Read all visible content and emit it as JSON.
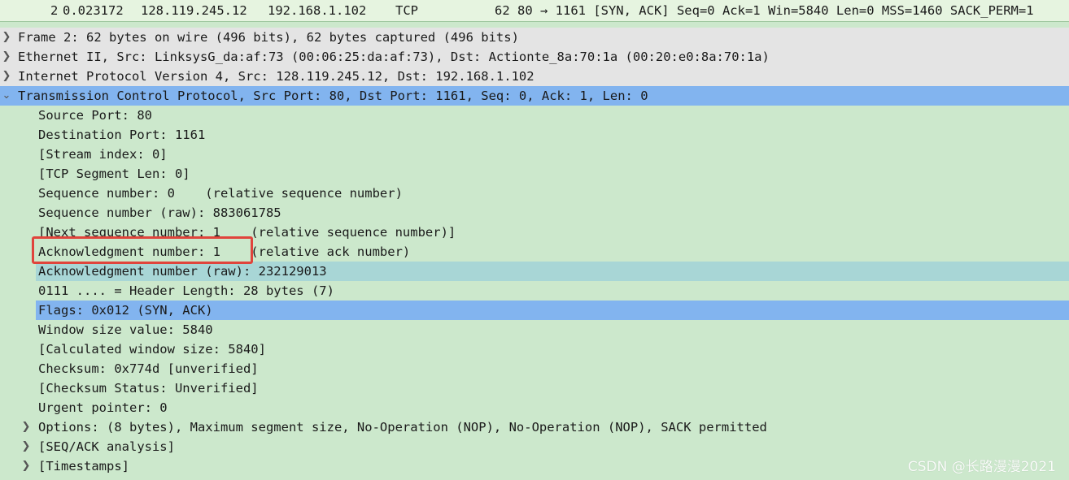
{
  "packet_row": {
    "no": "2",
    "time": "0.023172",
    "source": "128.119.245.12",
    "destination": "192.168.1.102",
    "protocol": "TCP",
    "info": "62 80 → 1161 [SYN, ACK] Seq=0 Ack=1 Win=5840 Len=0 MSS=1460 SACK_PERM=1"
  },
  "tree": {
    "frame": "Frame 2: 62 bytes on wire (496 bits), 62 bytes captured (496 bits)",
    "ethernet": "Ethernet II, Src: LinksysG_da:af:73 (00:06:25:da:af:73), Dst: Actionte_8a:70:1a (00:20:e0:8a:70:1a)",
    "ip": "Internet Protocol Version 4, Src: 128.119.245.12, Dst: 192.168.1.102",
    "tcp": "Transmission Control Protocol, Src Port: 80, Dst Port: 1161, Seq: 0, Ack: 1, Len: 0",
    "tcp_fields": {
      "source_port": "Source Port: 80",
      "destination_port": "Destination Port: 1161",
      "stream_index": "[Stream index: 0]",
      "segment_len": "[TCP Segment Len: 0]",
      "seq_number": "Sequence number: 0    (relative sequence number)",
      "seq_number_raw": "Sequence number (raw): 883061785",
      "next_seq": "[Next sequence number: 1    (relative sequence number)]",
      "ack_number": "Acknowledgment number: 1    (relative ack number)",
      "ack_number_raw": "Acknowledgment number (raw): 232129013",
      "header_length": "0111 .... = Header Length: 28 bytes (7)",
      "flags": "Flags: 0x012 (SYN, ACK)",
      "window_size": "Window size value: 5840",
      "calc_window": "[Calculated window size: 5840]",
      "checksum": "Checksum: 0x774d [unverified]",
      "checksum_status": "[Checksum Status: Unverified]",
      "urgent_pointer": "Urgent pointer: 0",
      "options": "Options: (8 bytes), Maximum segment size, No-Operation (NOP), No-Operation (NOP), SACK permitted",
      "seq_ack_analysis": "[SEQ/ACK analysis]",
      "timestamps": "[Timestamps]"
    }
  },
  "icons": {
    "collapsed": "chevron-right-icon",
    "expanded": "chevron-down-icon"
  },
  "watermark": "CSDN @长路漫漫2021",
  "colors": {
    "background": "#cce8cc",
    "selected_row": "#82b4ef",
    "related_field": "#a8d6d6",
    "annotation": "#e0443c"
  }
}
